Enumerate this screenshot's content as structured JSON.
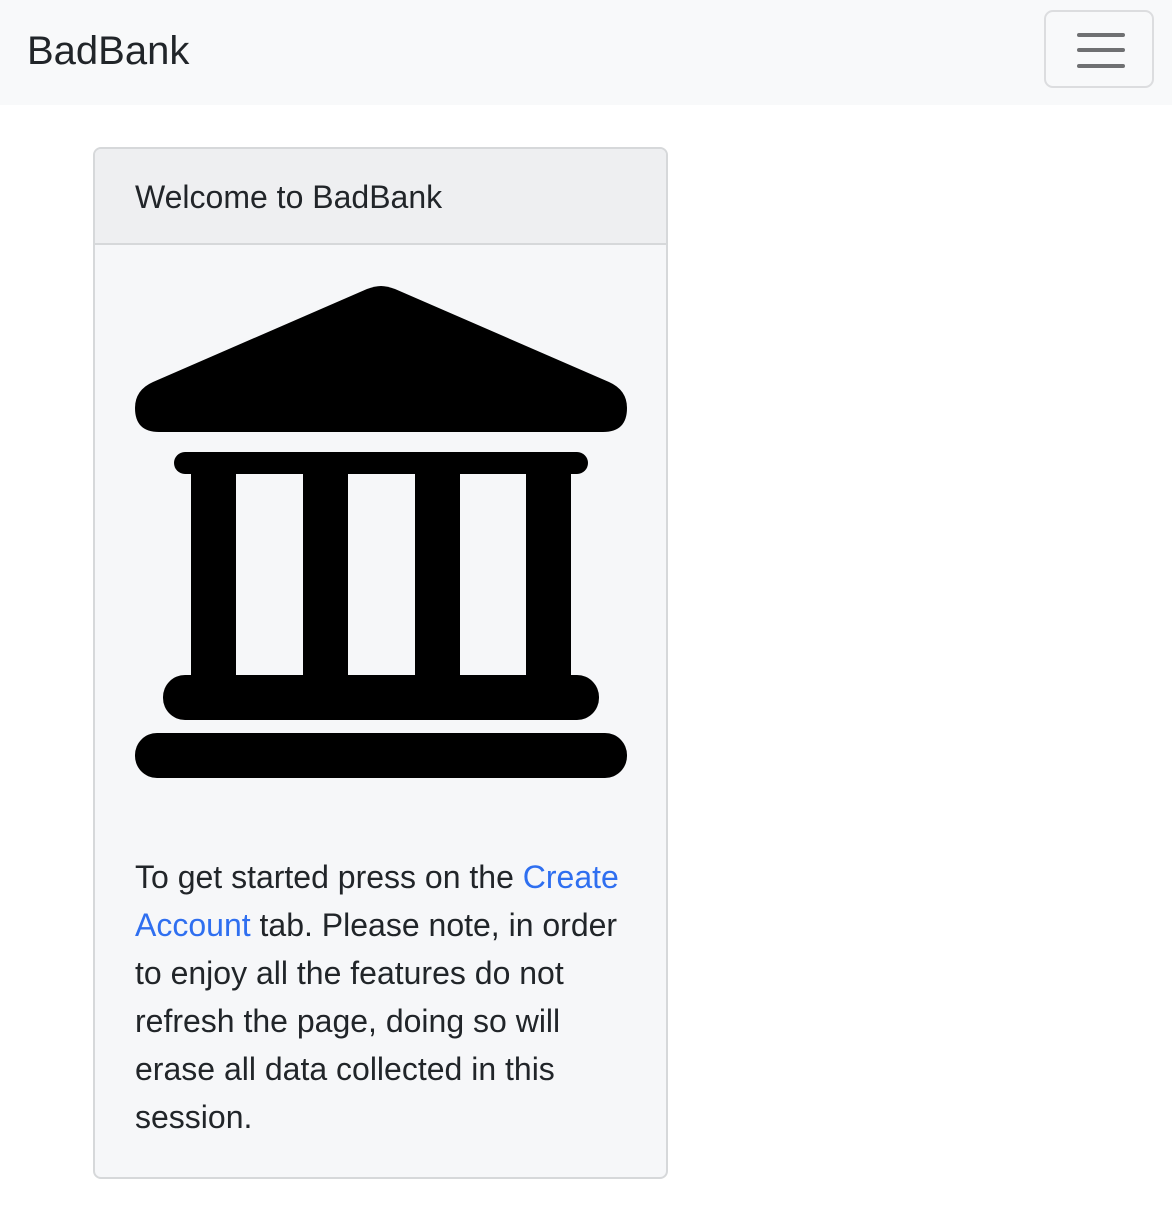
{
  "navbar": {
    "brand": "BadBank",
    "toggler_icon": "hamburger-menu-icon"
  },
  "card": {
    "header": "Welcome to BadBank",
    "icon": "bank-icon",
    "text_before": "To get started press on the ",
    "link": "Create Account",
    "text_after": " tab. Please note, in order to enjoy all the features do not refresh the page, doing so will erase all data collected in this session."
  },
  "colors": {
    "link": "#2f6ff0",
    "navbar_bg": "#f8f9fa"
  }
}
